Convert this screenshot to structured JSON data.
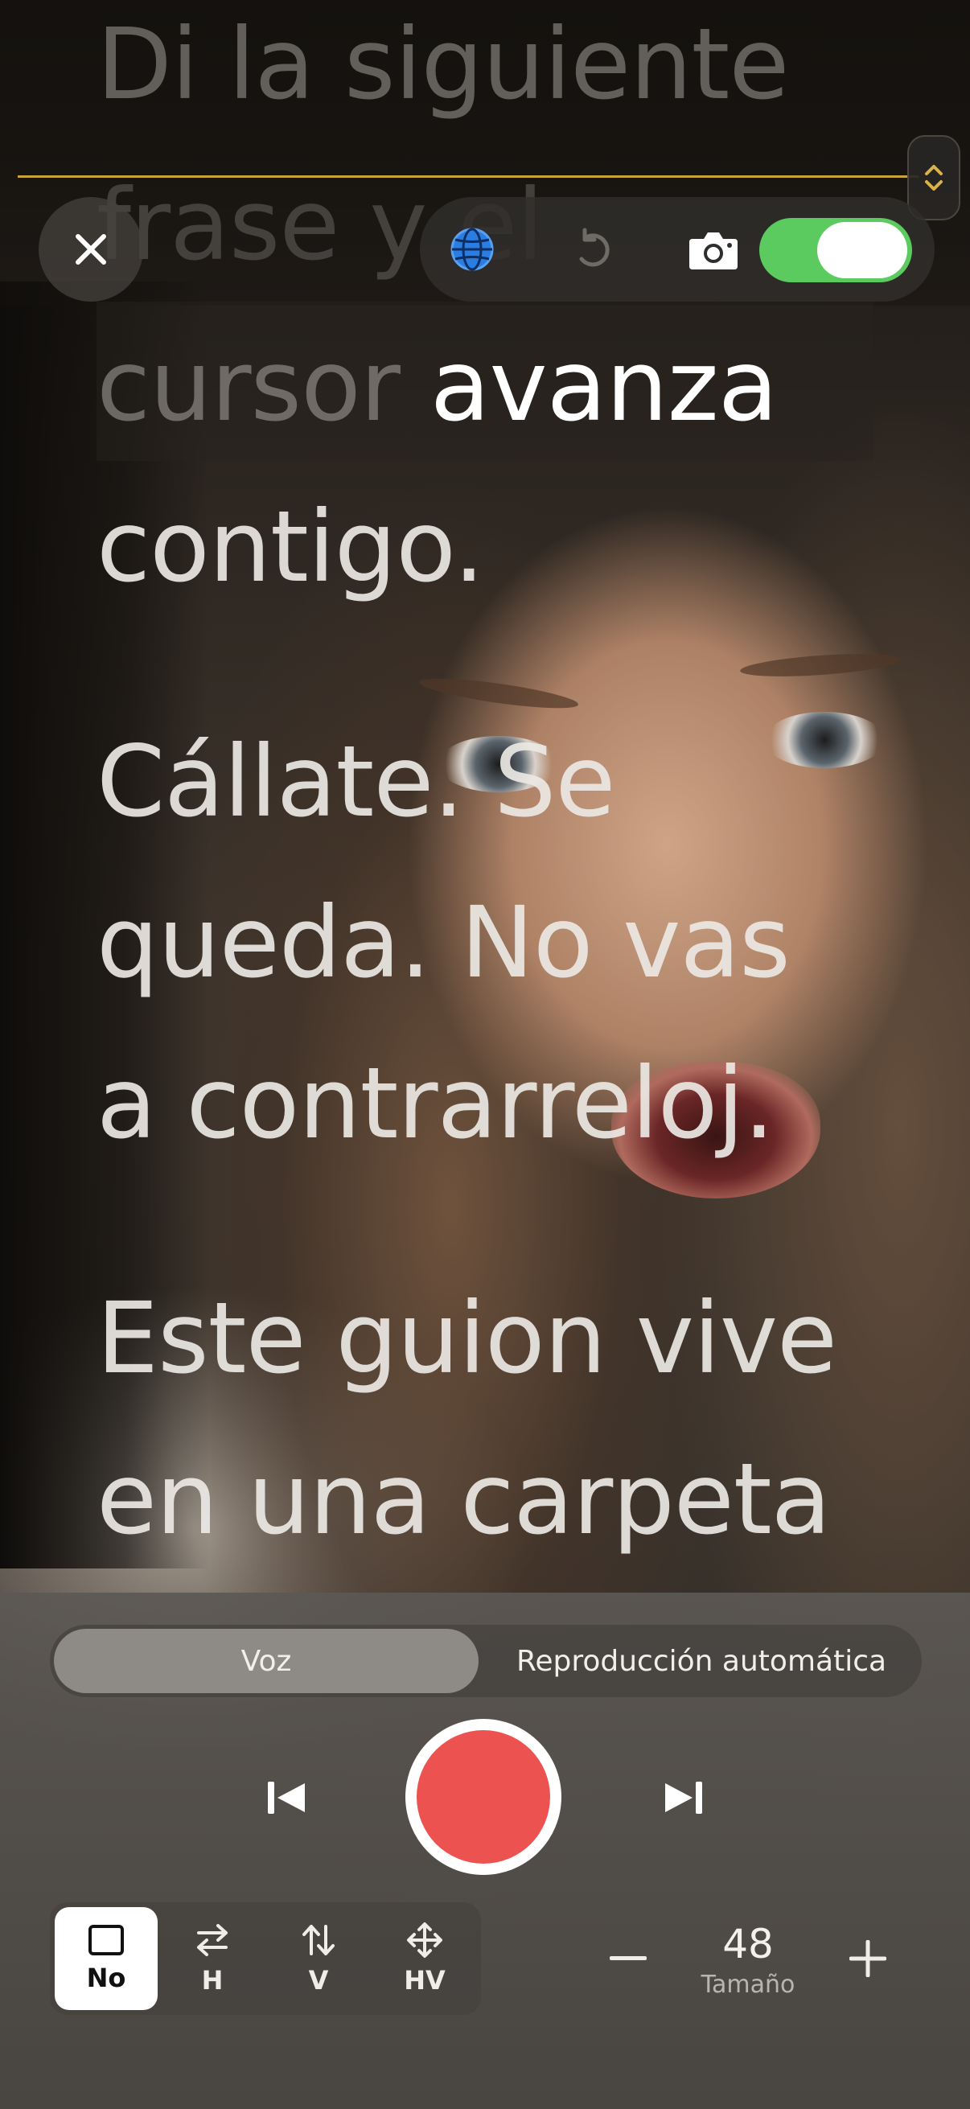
{
  "script": {
    "lines": [
      "Di la siguiente",
      "frase y el",
      "cursor ",
      "avanza",
      "contigo."
    ],
    "para2": [
      "Cállate. Se",
      "queda. No vas",
      "a contrarreloj."
    ],
    "para3": [
      "Este guion vive",
      "en una carpeta"
    ]
  },
  "toolbar": {
    "close_icon": "close-icon",
    "globe_icon": "globe-icon",
    "undo_icon": "undo-icon",
    "camera_icon": "camera-icon",
    "camera_toggle_on": true,
    "toggle_color": "#5ccb5f"
  },
  "mode": {
    "options": [
      "Voz",
      "Reproducción automática"
    ],
    "selected": "Voz"
  },
  "playback": {
    "prev_icon": "skip-back-icon",
    "record_icon": "record-icon",
    "next_icon": "skip-forward-icon",
    "record_color": "#ec5250"
  },
  "mirror": {
    "options": [
      {
        "label": "No",
        "icon": "square-icon"
      },
      {
        "label": "H",
        "icon": "arrows-horizontal-icon"
      },
      {
        "label": "V",
        "icon": "arrows-vertical-icon"
      },
      {
        "label": "HV",
        "icon": "arrows-move-icon"
      }
    ],
    "selected": "No"
  },
  "size": {
    "value": "48",
    "label": "Tamaño"
  },
  "guide_line_color": "#c7a43a"
}
